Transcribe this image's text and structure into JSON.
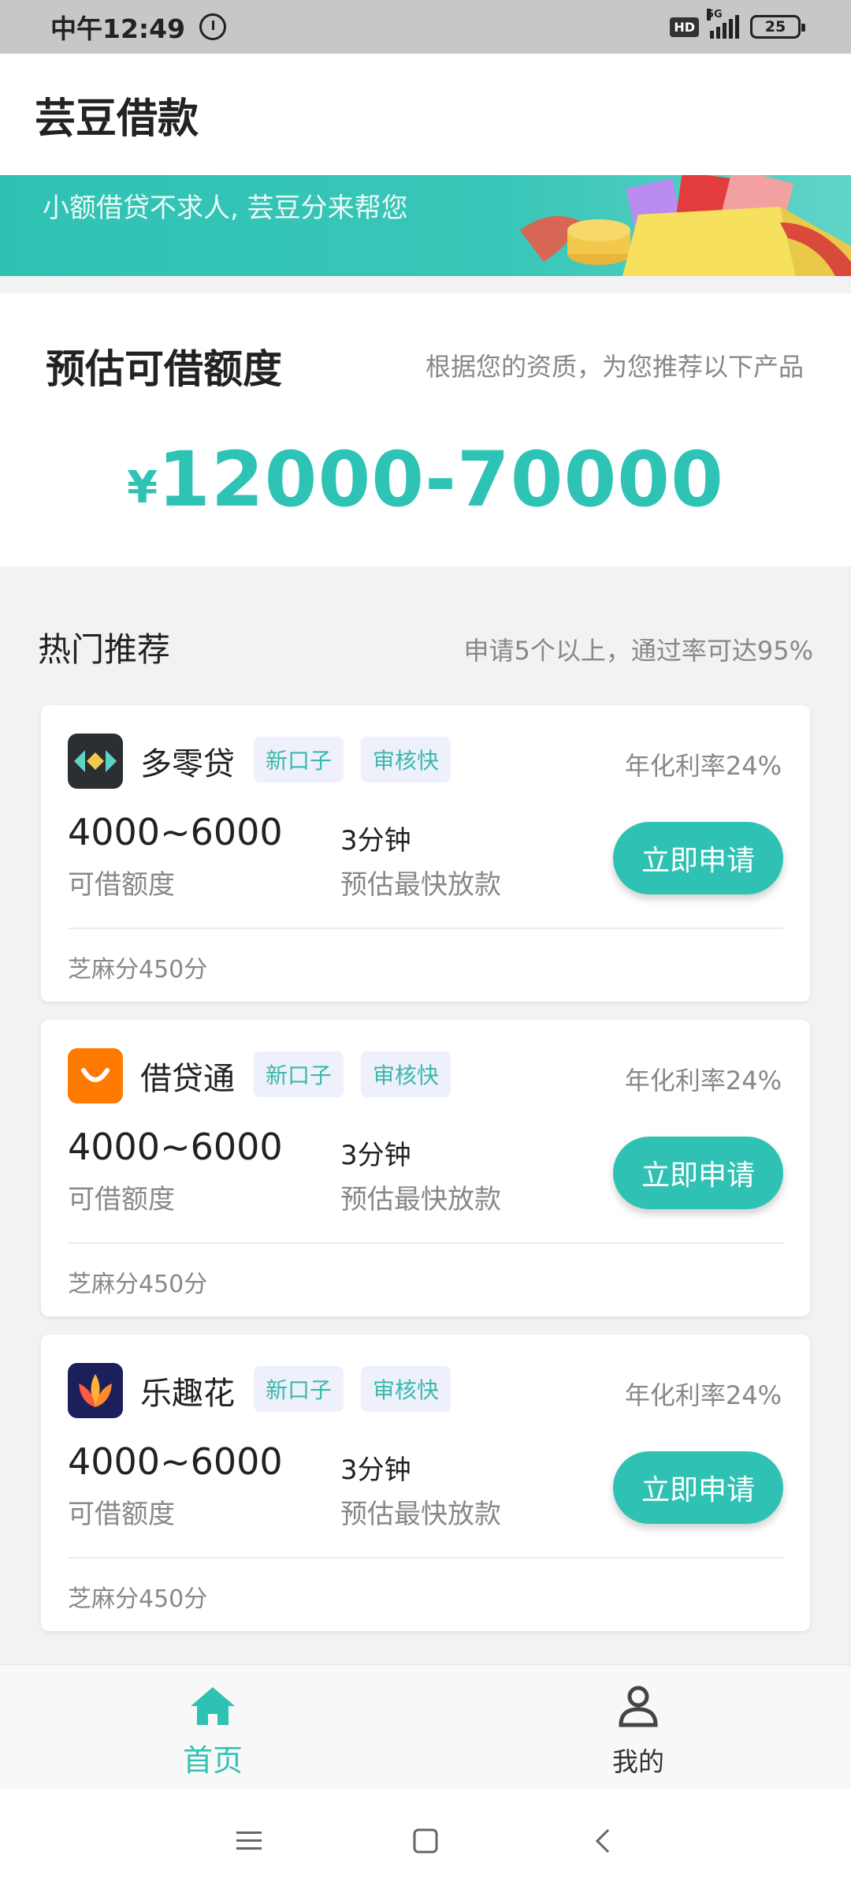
{
  "status_bar": {
    "time": "中午12:49",
    "hd": "HD",
    "network": "5G",
    "battery": "25"
  },
  "header": {
    "title": "芸豆借款"
  },
  "banner": {
    "text": "小额借贷不求人, 芸豆分来帮您"
  },
  "quota": {
    "title": "预估可借额度",
    "description": "根据您的资质，为您推荐以下产品",
    "currency": "¥",
    "amount": "12000-70000"
  },
  "hot": {
    "title": "热门推荐",
    "note": "申请5个以上，通过率可达95%"
  },
  "products": [
    {
      "name": "多零贷",
      "tags": [
        "新口子",
        "审核快"
      ],
      "rate": "年化利率24%",
      "amount": "4000~6000",
      "amount_label": "可借额度",
      "time": "3分钟",
      "time_label": "预估最快放款",
      "apply_label": "立即申请",
      "zhima": "芝麻分450分",
      "logo_icon": "duolingdai-logo-icon"
    },
    {
      "name": "借贷通",
      "tags": [
        "新口子",
        "审核快"
      ],
      "rate": "年化利率24%",
      "amount": "4000~6000",
      "amount_label": "可借额度",
      "time": "3分钟",
      "time_label": "预估最快放款",
      "apply_label": "立即申请",
      "zhima": "芝麻分450分",
      "logo_icon": "jiedaitong-logo-icon"
    },
    {
      "name": "乐趣花",
      "tags": [
        "新口子",
        "审核快"
      ],
      "rate": "年化利率24%",
      "amount": "4000~6000",
      "amount_label": "可借额度",
      "time": "3分钟",
      "time_label": "预估最快放款",
      "apply_label": "立即申请",
      "zhima": "芝麻分450分",
      "logo_icon": "lequhua-logo-icon"
    }
  ],
  "bottom_nav": {
    "home_label": "首页",
    "mine_label": "我的"
  },
  "colors": {
    "accent": "#2fc2b4",
    "tag_bg": "#eef1fb"
  }
}
